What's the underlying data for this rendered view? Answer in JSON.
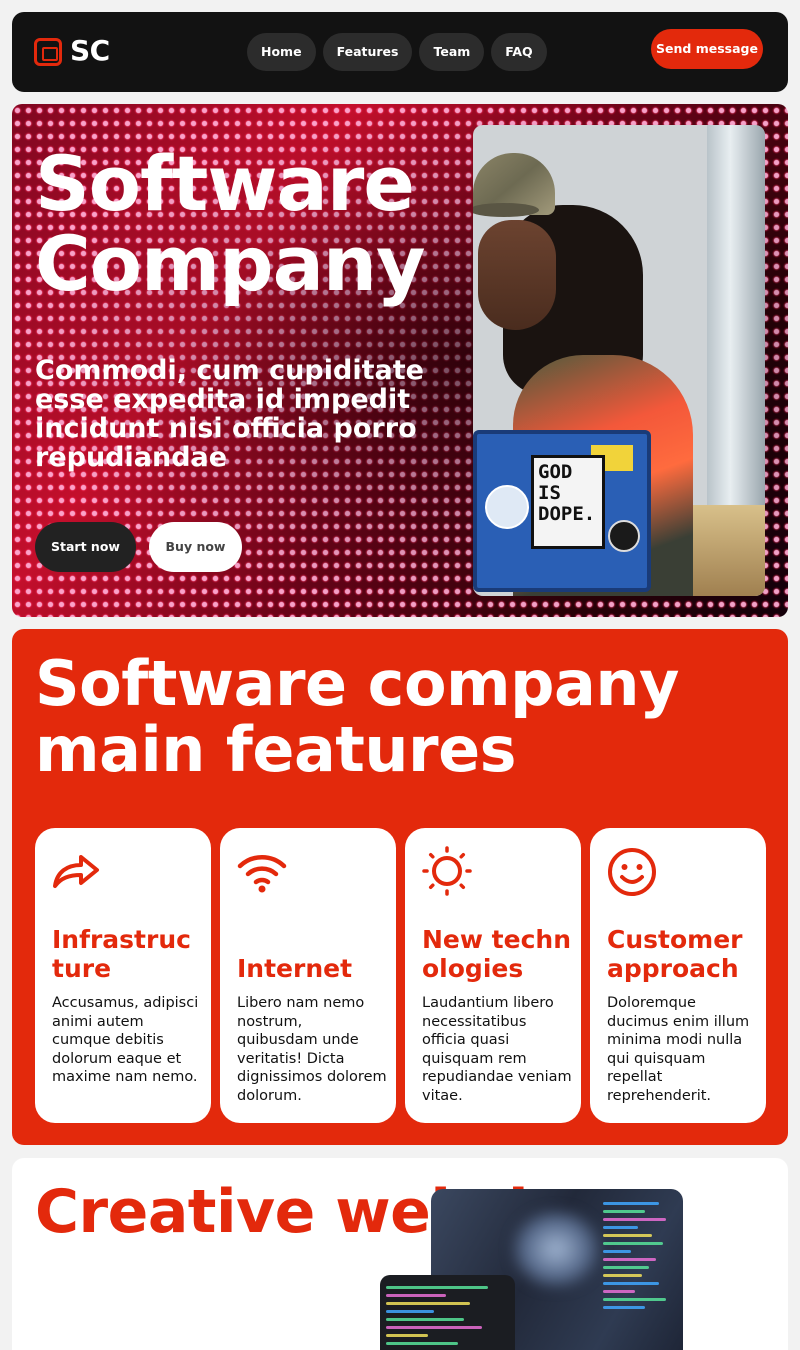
{
  "navbar": {
    "logo_text": "SC",
    "links": [
      "Home",
      "Features",
      "Team",
      "FAQ"
    ],
    "cta_label": "Send message"
  },
  "hero": {
    "title": "Software Company",
    "subtitle": "Commodi, cum cupiditate esse expedita id impedit incidunt nisi officia porro repudiandae",
    "primary_button": "Start now",
    "secondary_button": "Buy now",
    "photo_sticker_text": "GOD IS DOPE."
  },
  "features": {
    "title": "Software company main features",
    "cards": [
      {
        "icon": "share-arrow-icon",
        "title": "Infrastructure",
        "text": "Accusamus, adipisci animi autem cumque debitis dolorum eaque et maxime nam nemo."
      },
      {
        "icon": "wifi-icon",
        "title": "Internet",
        "text": "Libero nam nemo nostrum, quibusdam unde veritatis! Dicta dignissimos dolorem dolorum."
      },
      {
        "icon": "sun-icon",
        "title": "New technologies",
        "text": "Laudantium libero necessitatibus officia quasi quisquam rem repudiandae veniam vitae."
      },
      {
        "icon": "smile-icon",
        "title": "Customer approach",
        "text": "Doloremque ducimus enim illum minima modi nulla qui quisquam repellat reprehenderit."
      }
    ]
  },
  "creative": {
    "title": "Creative website"
  },
  "colors": {
    "accent": "#e3290c",
    "navbar_bg": "#121212",
    "page_bg": "#f2f2f2"
  }
}
